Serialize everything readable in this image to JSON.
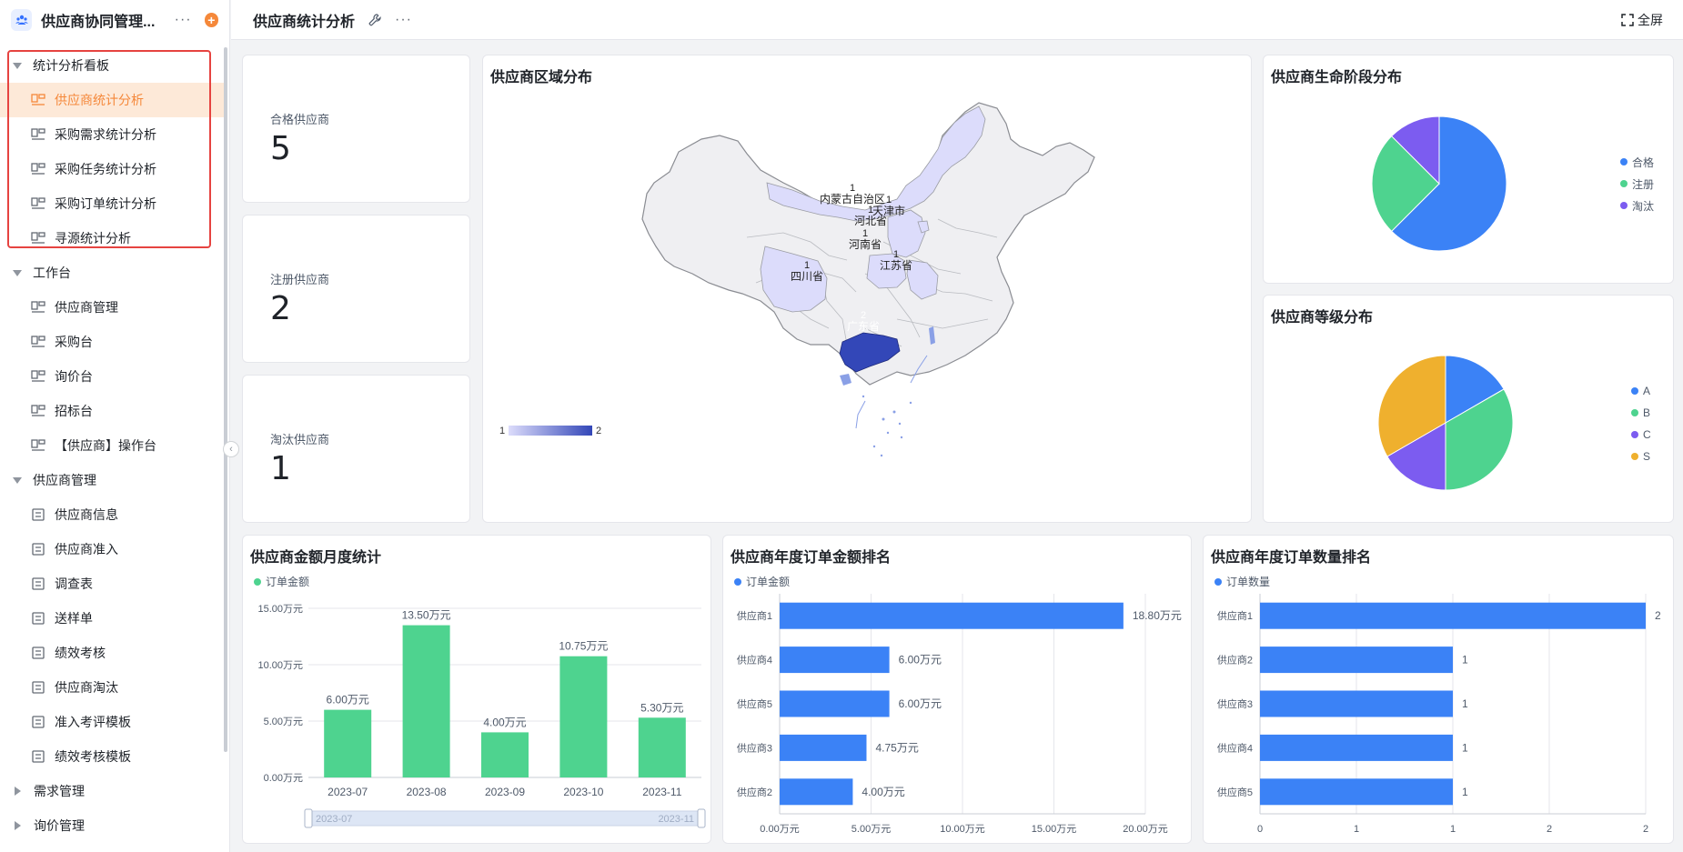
{
  "app": {
    "title": "供应商协同管理...",
    "more": "···",
    "plus": "+"
  },
  "sidebar": {
    "groups": [
      {
        "label": "统计分析看板",
        "expanded": true,
        "items": [
          {
            "label": "供应商统计分析",
            "active": true
          },
          {
            "label": "采购需求统计分析"
          },
          {
            "label": "采购任务统计分析"
          },
          {
            "label": "采购订单统计分析"
          },
          {
            "label": "寻源统计分析"
          }
        ]
      },
      {
        "label": "工作台",
        "expanded": true,
        "items": [
          {
            "label": "供应商管理"
          },
          {
            "label": "采购台"
          },
          {
            "label": "询价台"
          },
          {
            "label": "招标台"
          },
          {
            "label": "【供应商】操作台"
          }
        ]
      },
      {
        "label": "供应商管理",
        "expanded": true,
        "items": [
          {
            "label": "供应商信息"
          },
          {
            "label": "供应商准入"
          },
          {
            "label": "调查表"
          },
          {
            "label": "送样单"
          },
          {
            "label": "绩效考核"
          },
          {
            "label": "供应商淘汰"
          },
          {
            "label": "准入考评模板"
          },
          {
            "label": "绩效考核模板"
          }
        ]
      },
      {
        "label": "需求管理",
        "expanded": false,
        "items": []
      },
      {
        "label": "询价管理",
        "expanded": false,
        "items": []
      }
    ]
  },
  "topbar": {
    "title": "供应商统计分析",
    "more": "···",
    "fullscreen": "全屏"
  },
  "stats": [
    {
      "label": "合格供应商",
      "value": "5"
    },
    {
      "label": "注册供应商",
      "value": "2"
    },
    {
      "label": "淘汰供应商",
      "value": "1"
    }
  ],
  "map_card": {
    "title": "供应商区域分布",
    "regions": [
      {
        "name": "内蒙古自治区",
        "value": 1
      },
      {
        "name": "天津市",
        "value": 1
      },
      {
        "name": "河北省",
        "value": 1
      },
      {
        "name": "河南省",
        "value": 1
      },
      {
        "name": "江苏省",
        "value": 1
      },
      {
        "name": "四川省",
        "value": 1
      },
      {
        "name": "广东省",
        "value": 2
      }
    ],
    "scale_min": "1",
    "scale_max": "2",
    "colors": {
      "low": "#dcdcfb",
      "high": "#3347b8",
      "land": "#efeff2",
      "border": "#9a9ca3"
    }
  },
  "chart_data": [
    {
      "type": "pie",
      "title": "供应商生命阶段分布",
      "labels": [
        "合格",
        "注册",
        "淘汰"
      ],
      "values": [
        5,
        2,
        1
      ],
      "colors": [
        "#3b82f6",
        "#4ed38f",
        "#7c5cf0"
      ],
      "legend": "right"
    },
    {
      "type": "pie",
      "title": "供应商等级分布",
      "labels": [
        "A",
        "B",
        "C",
        "S"
      ],
      "values": [
        1,
        2,
        1,
        2
      ],
      "colors": [
        "#3b82f6",
        "#4ed38f",
        "#7c5cf0",
        "#efb02e"
      ],
      "legend": "right"
    },
    {
      "type": "bar",
      "title": "供应商金额月度统计",
      "series": [
        {
          "name": "订单金额",
          "values": [
            6.0,
            13.5,
            4.0,
            10.75,
            5.3
          ],
          "labels": [
            "6.00万元",
            "13.50万元",
            "4.00万元",
            "10.75万元",
            "5.30万元"
          ]
        }
      ],
      "categories": [
        "2023-07",
        "2023-08",
        "2023-09",
        "2023-10",
        "2023-11"
      ],
      "yticks": [
        "0.00万元",
        "5.00万元",
        "10.00万元",
        "15.00万元"
      ],
      "ylim": [
        0,
        15
      ],
      "color": "#4ed38f",
      "slider": {
        "start": "2023-07",
        "end": "2023-11"
      }
    },
    {
      "type": "bar",
      "orientation": "horizontal",
      "title": "供应商年度订单金额排名",
      "series": [
        {
          "name": "订单金额",
          "values": [
            18.8,
            6.0,
            6.0,
            4.75,
            4.0
          ],
          "labels": [
            "18.80万元",
            "6.00万元",
            "6.00万元",
            "4.75万元",
            "4.00万元"
          ]
        }
      ],
      "categories": [
        "供应商1",
        "供应商4",
        "供应商5",
        "供应商3",
        "供应商2"
      ],
      "xticks": [
        "0.00万元",
        "5.00万元",
        "10.00万元",
        "15.00万元",
        "20.00万元"
      ],
      "xlim": [
        0,
        20
      ],
      "color": "#3b82f6"
    },
    {
      "type": "bar",
      "orientation": "horizontal",
      "title": "供应商年度订单数量排名",
      "series": [
        {
          "name": "订单数量",
          "values": [
            2,
            1,
            1,
            1,
            1
          ],
          "labels": [
            "2",
            "1",
            "1",
            "1",
            "1"
          ]
        }
      ],
      "categories": [
        "供应商1",
        "供应商2",
        "供应商3",
        "供应商4",
        "供应商5"
      ],
      "xticks": [
        "0",
        "1",
        "1",
        "2",
        "2"
      ],
      "xlim": [
        0,
        2
      ],
      "color": "#3b82f6"
    }
  ]
}
